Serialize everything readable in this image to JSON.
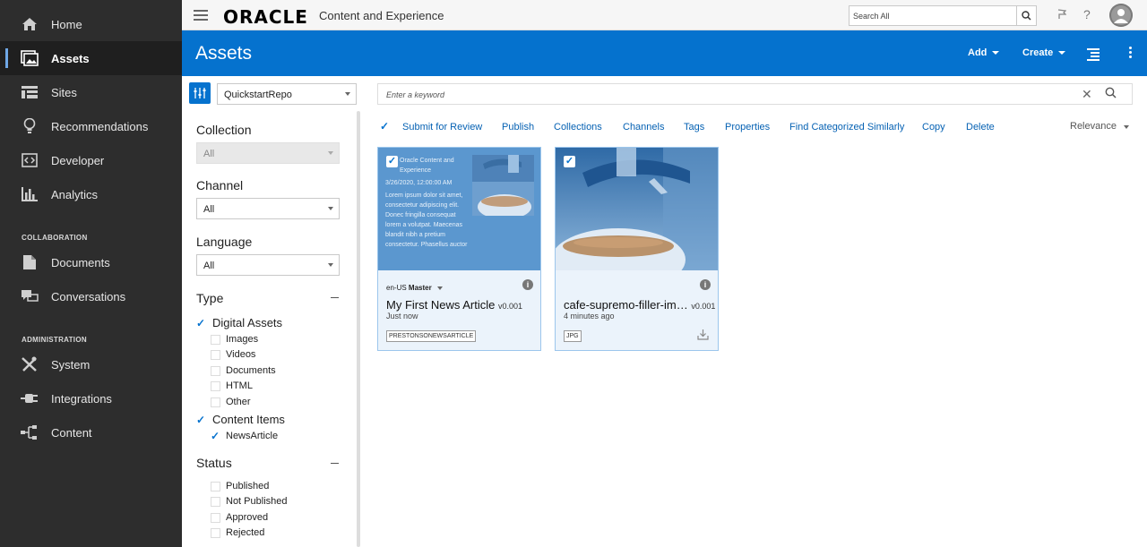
{
  "sidebar": {
    "items": [
      {
        "label": "Home",
        "icon": "home-icon"
      },
      {
        "label": "Assets",
        "icon": "assets-icon",
        "active": true
      },
      {
        "label": "Sites",
        "icon": "sites-icon"
      },
      {
        "label": "Recommendations",
        "icon": "lightbulb-icon"
      },
      {
        "label": "Developer",
        "icon": "developer-icon"
      },
      {
        "label": "Analytics",
        "icon": "analytics-icon"
      },
      {
        "label": "Documents",
        "icon": "documents-icon"
      },
      {
        "label": "Conversations",
        "icon": "conversations-icon"
      },
      {
        "label": "System",
        "icon": "tools-icon"
      },
      {
        "label": "Integrations",
        "icon": "plug-icon"
      },
      {
        "label": "Content",
        "icon": "content-icon"
      }
    ],
    "sections": {
      "collaboration": "COLLABORATION",
      "administration": "ADMINISTRATION"
    }
  },
  "topbar": {
    "logo": "ORACLE",
    "app_name": "Content and Experience",
    "search_placeholder": "Search All",
    "help": "?"
  },
  "header": {
    "title": "Assets",
    "add": "Add",
    "create": "Create",
    "accent": "#0572ce"
  },
  "filters": {
    "repository": "QuickstartRepo",
    "collection": {
      "heading": "Collection",
      "value": "All"
    },
    "channel": {
      "heading": "Channel",
      "value": "All"
    },
    "language": {
      "heading": "Language",
      "value": "All"
    },
    "type": {
      "heading": "Type",
      "digital_assets": "Digital Assets",
      "digital_options": [
        "Images",
        "Videos",
        "Documents",
        "HTML",
        "Other"
      ],
      "content_items": "Content Items",
      "content_options": [
        "NewsArticle"
      ]
    },
    "status": {
      "heading": "Status",
      "options": [
        "Published",
        "Not Published",
        "Approved",
        "Rejected"
      ]
    }
  },
  "search": {
    "placeholder": "Enter a keyword"
  },
  "actions": [
    "Submit for Review",
    "Publish",
    "Collections",
    "Channels",
    "Tags",
    "Properties",
    "Find Categorized Similarly",
    "Copy",
    "Delete"
  ],
  "sort": "Relevance",
  "cards": [
    {
      "thumb_title": "Oracle Content and Experience",
      "thumb_date": "3/26/2020, 12:00:00 AM",
      "thumb_body": "Lorem ipsum dolor sit amet, consectetur adipiscing elit. Donec fringilla consequat lorem a volutpat. Maecenas blandit nibh a pretium consectetur. Phasellus auctor eu neque sed ornare. Quisque porttitor",
      "language": "en-US",
      "master": "Master",
      "name": "My First News Article",
      "version": "v0.001",
      "time": "Just now",
      "tag": "PRESTONSONEWSARTICLE"
    },
    {
      "name": "cafe-supremo-filler-im…",
      "version": "v0.001",
      "time": "4 minutes ago",
      "tag": "JPG"
    }
  ]
}
